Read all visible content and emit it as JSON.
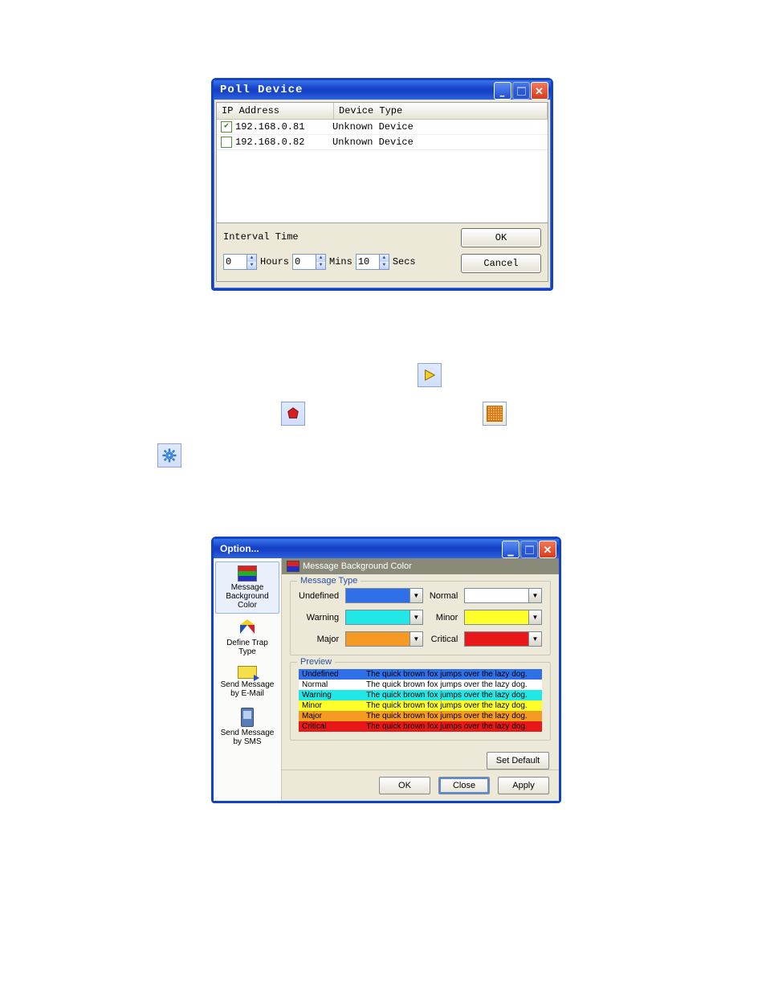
{
  "poll": {
    "title": "Poll Device",
    "cols": {
      "ip": "IP Address",
      "type": "Device Type"
    },
    "rows": [
      {
        "checked": true,
        "ip": "192.168.0.81",
        "type": "Unknown Device"
      },
      {
        "checked": false,
        "ip": "192.168.0.82",
        "type": "Unknown Device"
      }
    ],
    "interval_label": "Interval Time",
    "hours": {
      "value": "0",
      "label": "Hours"
    },
    "mins": {
      "value": "0",
      "label": "Mins"
    },
    "secs": {
      "value": "10",
      "label": "Secs"
    },
    "ok": "OK",
    "cancel": "Cancel"
  },
  "option": {
    "title": "Option...",
    "panel_title": "Message Background Color",
    "nav": {
      "bgcolor": "Message Background Color",
      "trap": "Define Trap Type",
      "email": "Send Message by E-Mail",
      "sms": "Send Message by SMS"
    },
    "group_msgtype": "Message Type",
    "group_preview": "Preview",
    "types": {
      "undefined": {
        "label": "Undefined",
        "color": "#2f6fe8"
      },
      "normal": {
        "label": "Normal",
        "color": "#ffffff"
      },
      "warning": {
        "label": "Warning",
        "color": "#22e7e7"
      },
      "minor": {
        "label": "Minor",
        "color": "#ffff2a"
      },
      "major": {
        "label": "Major",
        "color": "#f59a22"
      },
      "critical": {
        "label": "Critical",
        "color": "#e81818"
      }
    },
    "preview_text": "The quick brown fox jumps over the lazy dog.",
    "set_default": "Set Default",
    "ok": "OK",
    "close": "Close",
    "apply": "Apply"
  },
  "colors": {
    "preview_order": [
      "undefined",
      "normal",
      "warning",
      "minor",
      "major",
      "critical"
    ]
  }
}
